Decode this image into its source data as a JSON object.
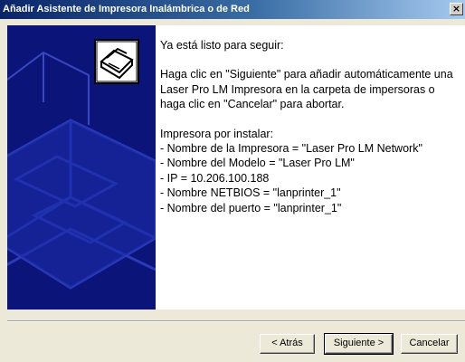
{
  "window": {
    "title": "Añadir Asistente de Impresora Inalámbrica o de Red",
    "close_glyph": "×"
  },
  "sidebar": {
    "icon": "printer-wizard-icon",
    "background_color": "#0b1478"
  },
  "content": {
    "heading": "Ya está listo para seguir:",
    "instructions": "Haga clic en \"Siguiente\" para añadir automáticamente una Laser Pro LM Impresora en la carpeta de impersoras o haga clic en \"Cancelar\" para abortar.",
    "install_label": "Impresora por instalar:",
    "details": [
      "- Nombre de la Impresora = \"Laser Pro LM Network\"",
      "- Nombre del Modelo = \"Laser Pro LM\"",
      "- IP = 10.206.100.188",
      "- Nombre NETBIOS = \"lanprinter_1\"",
      "- Nombre del puerto = \"lanprinter_1\""
    ]
  },
  "buttons": {
    "back": "< Atrás",
    "next": "Siguiente >",
    "cancel": "Cancelar"
  }
}
